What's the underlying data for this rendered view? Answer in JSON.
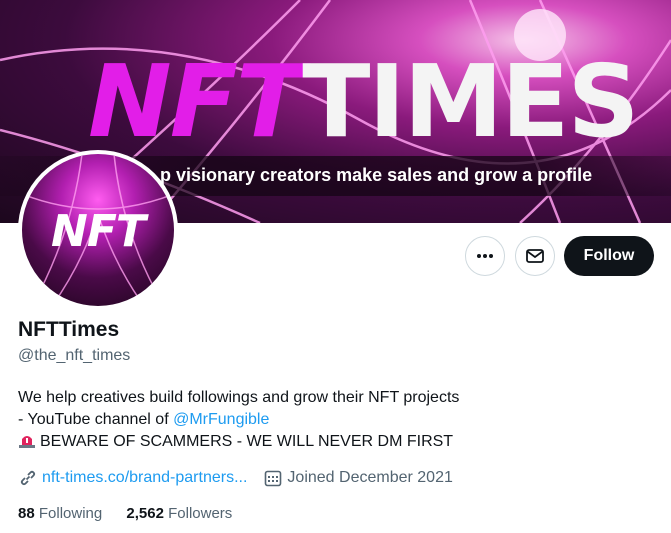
{
  "banner": {
    "title_nft": "NFT",
    "title_times": "TIMES",
    "tagline": "p visionary creators make sales and grow a profile"
  },
  "avatar": {
    "text": "NFT"
  },
  "actions": {
    "follow_label": "Follow",
    "more_icon": "more-horizontal-icon",
    "message_icon": "envelope-icon"
  },
  "profile": {
    "name": "NFTTimes",
    "handle": "@the_nft_times",
    "bio_line1": "We help creatives build followings and grow their NFT projects",
    "bio_line2_prefix": "- YouTube channel of ",
    "bio_line2_mention": "@MrFungible",
    "bio_line3": "BEWARE OF SCAMMERS - WE WILL NEVER DM FIRST",
    "website": "nft-times.co/brand-partners...",
    "joined": "Joined December 2021"
  },
  "stats": {
    "following_count": "88",
    "following_label": "Following",
    "followers_count": "2,562",
    "followers_label": "Followers"
  },
  "colors": {
    "accent": "#1d9bf0",
    "follow_bg": "#0f1419",
    "muted": "#536471",
    "brand_pink": "#e21ee8"
  }
}
